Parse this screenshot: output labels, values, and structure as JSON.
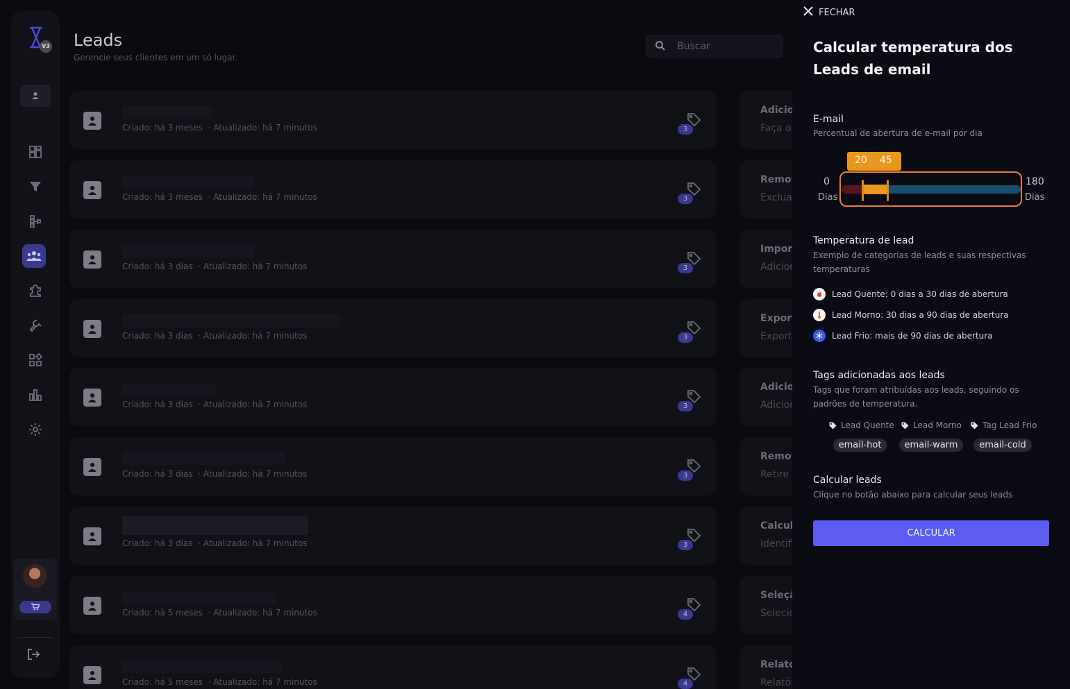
{
  "app": {
    "logo_icon": "hourglass-icon",
    "version_badge": "V3"
  },
  "sidebar": {
    "items": [
      {
        "icon": "dashboard-icon"
      },
      {
        "icon": "funnel-icon"
      },
      {
        "icon": "flow-icon"
      },
      {
        "icon": "people-icon",
        "active": true
      },
      {
        "icon": "puzzle-icon"
      },
      {
        "icon": "wrench-icon"
      },
      {
        "icon": "apps-icon"
      },
      {
        "icon": "bar-chart-icon"
      },
      {
        "icon": "gear-icon"
      }
    ],
    "cart_icon": "cart-icon",
    "logout_icon": "logout-icon"
  },
  "header": {
    "title": "Leads",
    "subtitle": "Gerencie seus clientes em um só lugar.",
    "search_placeholder": "Buscar"
  },
  "leads": [
    {
      "created": "Criado: há 3 meses",
      "updated": "Atualizado: há 7 minutos",
      "tags": "3"
    },
    {
      "created": "Criado: há 3 meses",
      "updated": "Atualizado: há 7 minutos",
      "tags": "3"
    },
    {
      "created": "Criado: há 3 dias",
      "updated": "Atualizado: há 7 minutos",
      "tags": "3"
    },
    {
      "created": "Criado: há 3 dias",
      "updated": "Atualizado: há 7 minutos",
      "tags": "3"
    },
    {
      "created": "Criado: há 3 dias",
      "updated": "Atualizado: há 7 minutos",
      "tags": "3"
    },
    {
      "created": "Criado: há 3 dias",
      "updated": "Atualizado: há 7 minutos",
      "tags": "3"
    },
    {
      "created": "Criado: há 3 dias",
      "updated": "Atualizado: há 7 minutos",
      "tags": "3"
    },
    {
      "created": "Criado: há 5 meses",
      "updated": "Atualizado: há 7 minutos",
      "tags": "4"
    },
    {
      "created": "Criado: há 5 meses",
      "updated": "Atualizado: há 7 minutos",
      "tags": "4"
    }
  ],
  "actions": [
    {
      "title": "Adicio",
      "desc": "Faça o"
    },
    {
      "title": "Remov",
      "desc": "Exclua"
    },
    {
      "title": "Import",
      "desc": "Adicion"
    },
    {
      "title": "Export",
      "desc": "Exporte"
    },
    {
      "title": "Adicio",
      "desc": "Adicion"
    },
    {
      "title": "Remov",
      "desc": "Retire a"
    },
    {
      "title": "Calcula",
      "desc": "Identifi"
    },
    {
      "title": "Seleçã",
      "desc": "Selecio"
    },
    {
      "title": "Relató",
      "desc": "Relatór"
    }
  ],
  "drawer": {
    "close_label": "FECHAR",
    "title": "Calcular temperatura dos Leads de email",
    "email": {
      "title": "E-mail",
      "desc": "Percentual de abertura de e-mail por dia",
      "slider": {
        "min": 0,
        "max": 180,
        "low": 20,
        "high": 45,
        "min_label": "0",
        "max_label": "180",
        "low_label": "20",
        "high_label": "45",
        "unit": "Dias",
        "colors": {
          "hot": "#5a1420",
          "warm": "#e8961e",
          "cold": "#17506e",
          "border": "#f07a3a"
        }
      }
    },
    "temperature": {
      "title": "Temperatura de lead",
      "desc": "Exemplo de categorias de leads e suas respectivas temperaturas",
      "items": [
        {
          "icon": "fire-icon",
          "text": "Lead Quente: 0 dias a 30 dias de abertura"
        },
        {
          "icon": "thermometer-icon",
          "text": "Lead Morno: 30 dias a 90 dias de abertura"
        },
        {
          "icon": "snowflake-icon",
          "text": "Lead Frio: mais de 90 dias de abertura"
        }
      ]
    },
    "tags": {
      "title": "Tags adicionadas aos leads",
      "desc": "Tags que foram atribuídas aos leads, seguindo os padrões de temperatura.",
      "labels": [
        "Lead Quente",
        "Lead Morno",
        "Tag Lead Frio"
      ],
      "chips": [
        "email-hot",
        "email-warm",
        "email-cold"
      ]
    },
    "calculate": {
      "title": "Calcular leads",
      "desc": "Clique no botão abaixo para calcular seus leads",
      "button": "CALCULAR"
    }
  }
}
